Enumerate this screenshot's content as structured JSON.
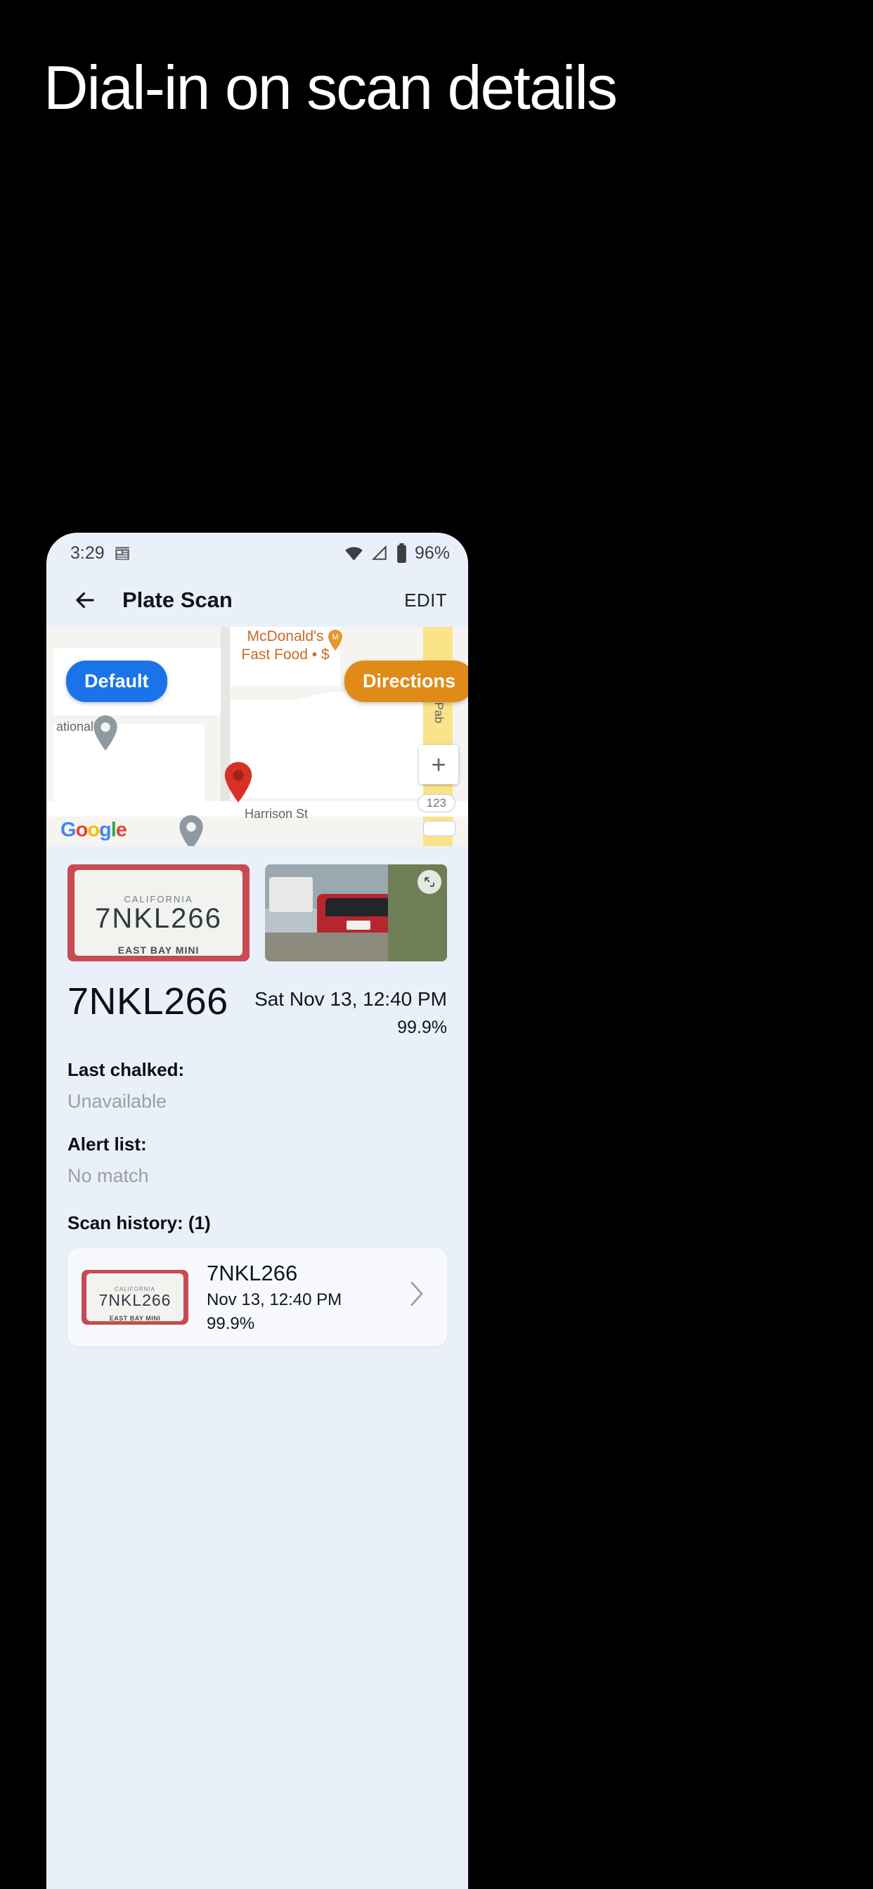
{
  "promo": {
    "headline": "Dial-in on scan details"
  },
  "status_bar": {
    "time": "3:29",
    "notification_icon": "news-icon",
    "wifi_icon": "wifi-icon",
    "signal_icon": "cell-signal-icon",
    "battery_icon": "battery-icon",
    "battery_percent": "96%"
  },
  "toolbar": {
    "back_icon": "back-arrow-icon",
    "title": "Plate Scan",
    "edit_label": "EDIT"
  },
  "map": {
    "default_chip": "Default",
    "directions_chip": "Directions",
    "poi_name": "McDonald's",
    "poi_sub": "Fast Food • $",
    "street_label": "Harrison St",
    "street_vertical": "San Pab",
    "partial_label": "ational",
    "zoom_in": "+",
    "scale_123": "123",
    "watermark": "Google",
    "colors": {
      "default_chip": "#1a73e8",
      "directions_chip": "#e08a17",
      "pin": "#d93025"
    }
  },
  "scan": {
    "plate_photo_alt": "license-plate-photo",
    "plate_photo_text": {
      "top": "CALIFORNIA",
      "number": "7NKL266",
      "bottom": "EAST BAY MINI"
    },
    "car_photo_alt": "vehicle-photo",
    "expand_icon": "expand-icon",
    "plate_number": "7NKL266",
    "timestamp": "Sat Nov 13, 12:40 PM",
    "confidence": "99.9%",
    "fields": [
      {
        "label": "Last chalked:",
        "value": "Unavailable"
      },
      {
        "label": "Alert list:",
        "value": "No match"
      }
    ],
    "history_label": "Scan history: (1)",
    "history": [
      {
        "plate": "7NKL266",
        "date": "Nov 13, 12:40 PM",
        "confidence": "99.9%",
        "chevron_icon": "chevron-right-icon",
        "thumb_text": {
          "top": "CALIFORNIA",
          "number": "7NKL266",
          "bottom": "EAST BAY MINI"
        }
      }
    ]
  }
}
